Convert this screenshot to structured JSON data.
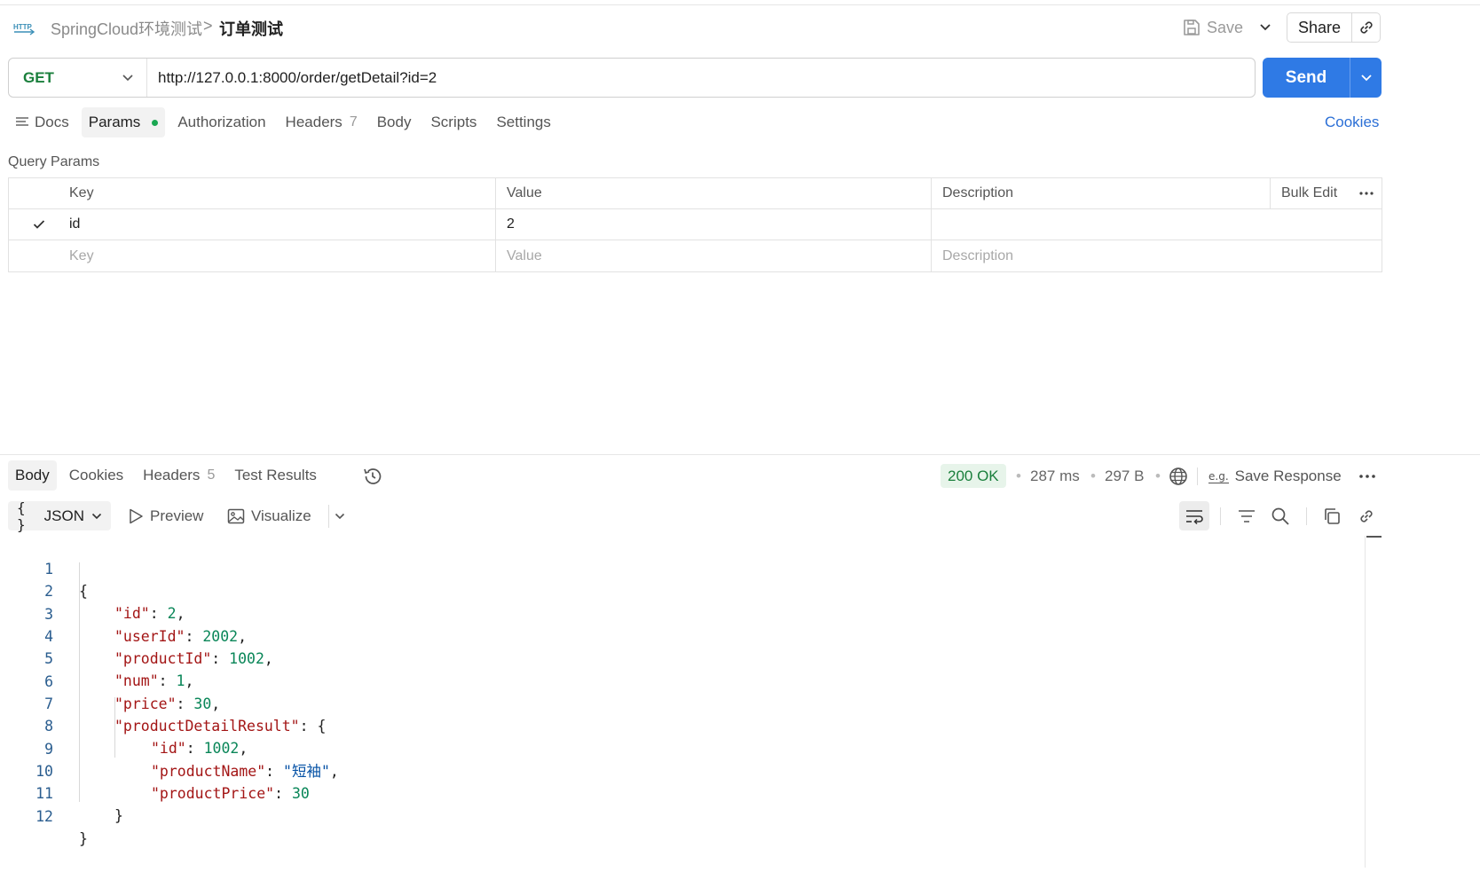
{
  "header": {
    "http_icon_label": "HTTP",
    "breadcrumb_parent": "SpringCloud环境测试",
    "breadcrumb_separator": ">",
    "breadcrumb_current": "订单测试",
    "save_label": "Save",
    "share_label": "Share"
  },
  "request": {
    "method": "GET",
    "url": "http://127.0.0.1:8000/order/getDetail?id=2",
    "send_label": "Send"
  },
  "request_tabs": [
    {
      "label": "Docs",
      "count": ""
    },
    {
      "label": "Params",
      "count": ""
    },
    {
      "label": "Authorization",
      "count": ""
    },
    {
      "label": "Headers",
      "count": "7"
    },
    {
      "label": "Body",
      "count": ""
    },
    {
      "label": "Scripts",
      "count": ""
    },
    {
      "label": "Settings",
      "count": ""
    }
  ],
  "cookies_label": "Cookies",
  "query_params": {
    "title": "Query Params",
    "headers": {
      "key": "Key",
      "value": "Value",
      "description": "Description",
      "bulk_edit": "Bulk Edit"
    },
    "rows": [
      {
        "key": "id",
        "value": "2",
        "description": "",
        "enabled": true
      }
    ],
    "placeholders": {
      "key": "Key",
      "value": "Value",
      "description": "Description"
    }
  },
  "response_tabs": [
    {
      "label": "Body",
      "count": ""
    },
    {
      "label": "Cookies",
      "count": ""
    },
    {
      "label": "Headers",
      "count": "5"
    },
    {
      "label": "Test Results",
      "count": ""
    }
  ],
  "response_meta": {
    "status": "200 OK",
    "time": "287 ms",
    "size": "297 B",
    "save_response_label": "Save Response",
    "eg_label": "e.g."
  },
  "response_toolbar": {
    "format_label": "JSON",
    "format_braces": "{ }",
    "preview_label": "Preview",
    "visualize_label": "Visualize"
  },
  "response_body": {
    "line_numbers": [
      "1",
      "2",
      "3",
      "4",
      "5",
      "6",
      "7",
      "8",
      "9",
      "10",
      "11",
      "12"
    ],
    "open_brace": "{",
    "close_brace": "}",
    "fields": [
      {
        "key": "\"id\"",
        "value": "2"
      },
      {
        "key": "\"userId\"",
        "value": "2002"
      },
      {
        "key": "\"productId\"",
        "value": "1002"
      },
      {
        "key": "\"num\"",
        "value": "1"
      },
      {
        "key": "\"price\"",
        "value": "30"
      },
      {
        "key": "\"productDetailResult\"",
        "value": "{"
      }
    ],
    "nested_fields": [
      {
        "key": "\"id\"",
        "value": "1002"
      },
      {
        "key": "\"productName\"",
        "value": "\"短袖\""
      },
      {
        "key": "\"productPrice\"",
        "value": "30"
      }
    ]
  },
  "colors": {
    "accent_blue": "#2f7ae5",
    "method_green": "#1a7f3c",
    "status_bg": "#e7f4ea",
    "json_key": "#a31515",
    "json_number": "#098658",
    "json_string": "#0451a5"
  }
}
